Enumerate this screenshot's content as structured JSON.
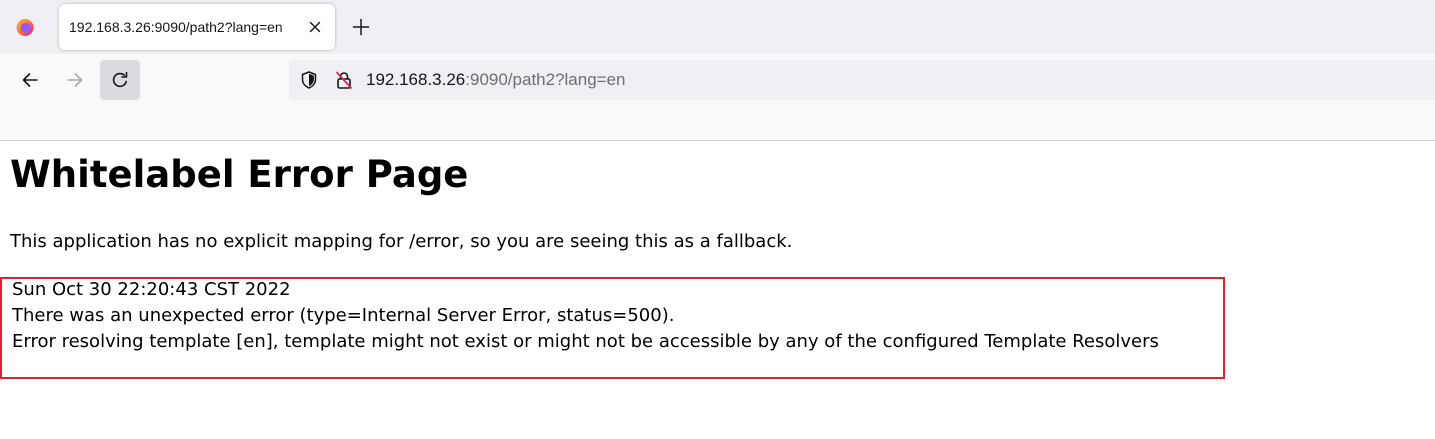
{
  "browser": {
    "active_tab": {
      "title": "192.168.3.26:9090/path2?lang=en"
    },
    "url": {
      "host": "192.168.3.26",
      "rest": ":9090/path2?lang=en"
    },
    "icons": {
      "logo": "firefox-logo-icon",
      "tab_close": "close-icon",
      "new_tab": "plus-icon",
      "back": "arrow-left-icon",
      "forward": "arrow-right-icon",
      "reload": "reload-icon",
      "tracking": "shield-icon",
      "insecure": "insecure-lock-icon"
    }
  },
  "page": {
    "title": "Whitelabel Error Page",
    "explanation": "This application has no explicit mapping for /error, so you are seeing this as a fallback.",
    "error": {
      "timestamp": "Sun Oct 30 22:20:43 CST 2022",
      "summary": "There was an unexpected error (type=Internal Server Error, status=500).",
      "detail": "Error resolving template [en], template might not exist or might not be accessible by any of the configured Template Resolvers"
    }
  },
  "colors": {
    "highlight_border": "#e0212f",
    "insecure_slash": "#e22850",
    "firefox_orange": "#ff7139",
    "firefox_purple": "#9059ff"
  }
}
